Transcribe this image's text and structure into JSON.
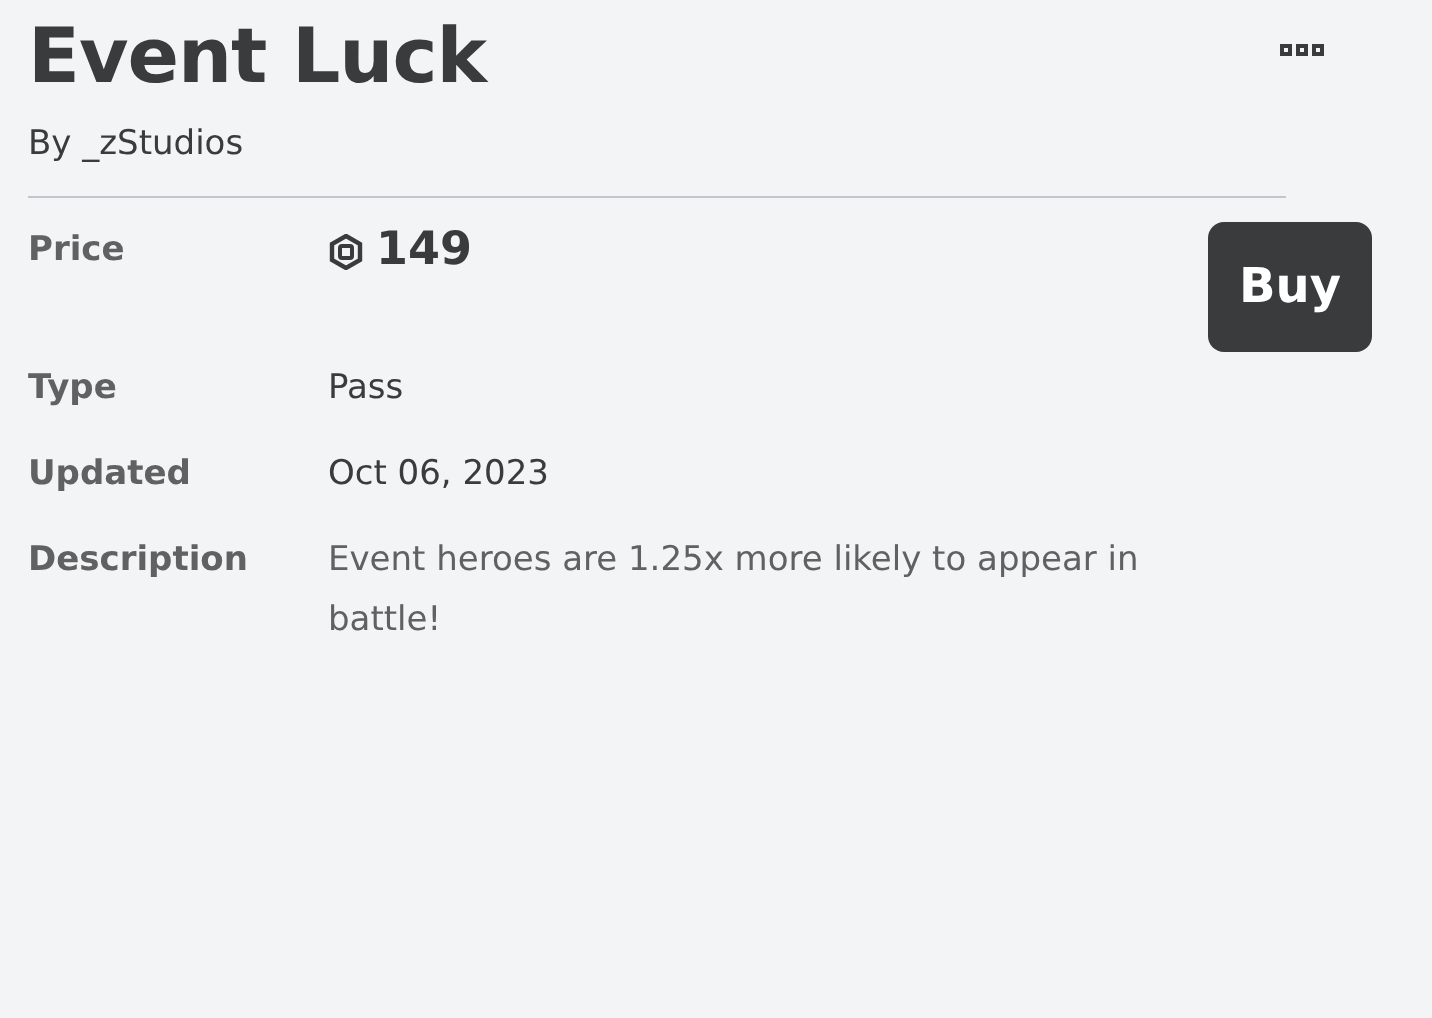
{
  "title": "Event Luck",
  "creator": "By _zStudios",
  "price": {
    "label": "Price",
    "amount": "149"
  },
  "buy_button": "Buy",
  "details": [
    {
      "label": "Type",
      "value": "Pass",
      "kind": "plain"
    },
    {
      "label": "Updated",
      "value": "Oct 06, 2023",
      "kind": "plain"
    },
    {
      "label": "Description",
      "value": "Event heroes are 1.25x more likely to appear in battle!",
      "kind": "description"
    }
  ]
}
